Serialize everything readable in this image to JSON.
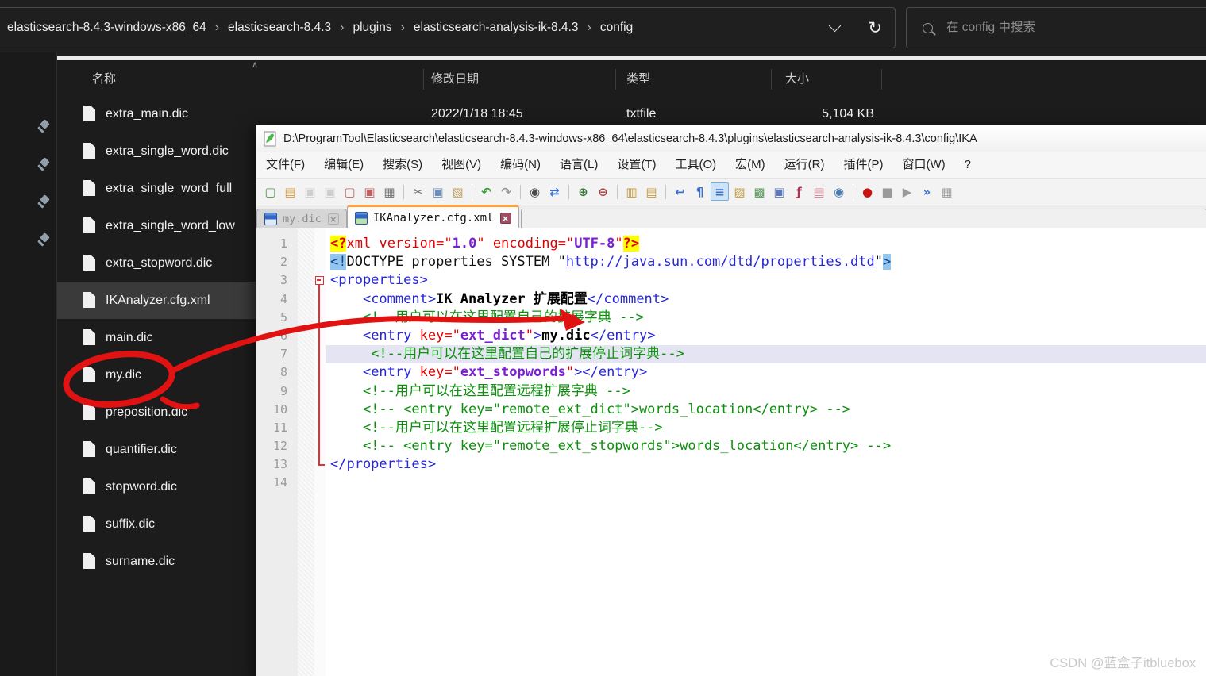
{
  "explorer": {
    "breadcrumb": [
      "elasticsearch-8.4.3-windows-x86_64",
      "elasticsearch-8.4.3",
      "plugins",
      "elasticsearch-analysis-ik-8.4.3",
      "config"
    ],
    "search_placeholder": "在 config 中搜索",
    "icons": {
      "refresh": "↻",
      "sort_ascending": "∧"
    },
    "columns": [
      "名称",
      "修改日期",
      "类型",
      "大小"
    ],
    "pin_count": 4,
    "files": [
      {
        "name": "extra_main.dic",
        "date": "2022/1/18 18:45",
        "type": "txtfile",
        "size": "5,104 KB"
      },
      {
        "name": "extra_single_word.dic"
      },
      {
        "name": "extra_single_word_full"
      },
      {
        "name": "extra_single_word_low"
      },
      {
        "name": "extra_stopword.dic"
      },
      {
        "name": "IKAnalyzer.cfg.xml",
        "selected": true
      },
      {
        "name": "main.dic"
      },
      {
        "name": "my.dic",
        "circled": true
      },
      {
        "name": "preposition.dic"
      },
      {
        "name": "quantifier.dic"
      },
      {
        "name": "stopword.dic"
      },
      {
        "name": "suffix.dic"
      },
      {
        "name": "surname.dic"
      }
    ]
  },
  "notepad": {
    "title": "D:\\ProgramTool\\Elasticsearch\\elasticsearch-8.4.3-windows-x86_64\\elasticsearch-8.4.3\\plugins\\elasticsearch-analysis-ik-8.4.3\\config\\IKA",
    "menus": [
      "文件(F)",
      "编辑(E)",
      "搜索(S)",
      "视图(V)",
      "编码(N)",
      "语言(L)",
      "设置(T)",
      "工具(O)",
      "宏(M)",
      "运行(R)",
      "插件(P)",
      "窗口(W)",
      "?"
    ],
    "toolbar": [
      {
        "name": "new-file",
        "glyph": "▢",
        "color": "#4a9a4a"
      },
      {
        "name": "open-file",
        "glyph": "▤",
        "color": "#d89b3c"
      },
      {
        "name": "save",
        "glyph": "▣",
        "color": "#9a9a9a",
        "disabled": true
      },
      {
        "name": "save-all",
        "glyph": "▣",
        "color": "#9a9a9a",
        "disabled": true
      },
      {
        "name": "close",
        "glyph": "▢",
        "color": "#c06060"
      },
      {
        "name": "close-all",
        "glyph": "▣",
        "color": "#c06060"
      },
      {
        "name": "print",
        "glyph": "▦",
        "color": "#707070"
      },
      {
        "sep": true
      },
      {
        "name": "cut",
        "glyph": "✂",
        "color": "#707070"
      },
      {
        "name": "copy",
        "glyph": "▣",
        "color": "#6f8fc0"
      },
      {
        "name": "paste",
        "glyph": "▧",
        "color": "#c0a060"
      },
      {
        "sep": true
      },
      {
        "name": "undo",
        "glyph": "↶",
        "color": "#2e9e2e"
      },
      {
        "name": "redo",
        "glyph": "↷",
        "color": "#9a9a9a"
      },
      {
        "sep": true
      },
      {
        "name": "find",
        "glyph": "◉",
        "color": "#4a4a4a"
      },
      {
        "name": "replace",
        "glyph": "⇄",
        "color": "#3a6fd0"
      },
      {
        "sep": true
      },
      {
        "name": "zoom-in",
        "glyph": "⊕",
        "color": "#3a7a3a"
      },
      {
        "name": "zoom-out",
        "glyph": "⊖",
        "color": "#b04040"
      },
      {
        "sep": true
      },
      {
        "name": "sync-vertical",
        "glyph": "▥",
        "color": "#c89a3c"
      },
      {
        "name": "sync-horizontal",
        "glyph": "▤",
        "color": "#c89a3c"
      },
      {
        "sep": true
      },
      {
        "name": "word-wrap",
        "glyph": "↩",
        "color": "#3a6fd0"
      },
      {
        "name": "show-all-characters",
        "glyph": "¶",
        "color": "#3a6fd0"
      },
      {
        "name": "indent-guide",
        "glyph": "≡",
        "color": "#3a6fd0",
        "active": true
      },
      {
        "name": "shortcut-mapper",
        "glyph": "▨",
        "color": "#c0a040"
      },
      {
        "name": "document-map",
        "glyph": "▩",
        "color": "#5a9a5a"
      },
      {
        "name": "document-switcher",
        "glyph": "▣",
        "color": "#5a7ac0"
      },
      {
        "name": "function-list",
        "glyph": "ƒ",
        "color": "#b03050"
      },
      {
        "name": "folder-as-workspace",
        "glyph": "▤",
        "color": "#d08090"
      },
      {
        "name": "monitoring-eye",
        "glyph": "◉",
        "color": "#4a7ab0"
      },
      {
        "sep": true
      },
      {
        "name": "macro-record",
        "glyph": "●",
        "color": "#cc1111"
      },
      {
        "name": "macro-stop",
        "glyph": "■",
        "color": "#9a9a9a"
      },
      {
        "name": "macro-play",
        "glyph": "▶",
        "color": "#9a9a9a"
      },
      {
        "name": "macro-run-multiple",
        "glyph": "»",
        "color": "#3a6fd0"
      },
      {
        "name": "macro-save",
        "glyph": "▦",
        "color": "#9a9a9a"
      }
    ],
    "tabs": [
      {
        "label": "my.dic",
        "active": false
      },
      {
        "label": "IKAnalyzer.cfg.xml",
        "active": true
      }
    ],
    "code": {
      "lines": [
        {
          "n": 1,
          "segs": [
            [
              "y",
              "<?"
            ],
            [
              "r",
              "xml"
            ],
            [
              "k",
              " "
            ],
            [
              "r",
              "version="
            ],
            [
              "q",
              "\""
            ],
            [
              "v",
              "1.0"
            ],
            [
              "q",
              "\""
            ],
            [
              "k",
              " "
            ],
            [
              "r",
              "encoding="
            ],
            [
              "q",
              "\""
            ],
            [
              "v",
              "UTF-8"
            ],
            [
              "q",
              "\""
            ],
            [
              "y",
              "?>"
            ]
          ]
        },
        {
          "n": 2,
          "segs": [
            [
              "hb",
              "<!"
            ],
            [
              "k",
              "DOCTYPE properties SYSTEM \""
            ],
            [
              "u",
              "http://java.sun.com/dtd/properties.dtd"
            ],
            [
              "k",
              "\""
            ],
            [
              "hb",
              ">"
            ]
          ]
        },
        {
          "n": 3,
          "fold": "start",
          "segs": [
            [
              "b",
              "<properties>"
            ]
          ]
        },
        {
          "n": 4,
          "fold": "line",
          "segs": [
            [
              "k",
              "    "
            ],
            [
              "b",
              "<comment>"
            ],
            [
              "t",
              "IK Analyzer 扩展配置"
            ],
            [
              "b",
              "</comment>"
            ]
          ]
        },
        {
          "n": 5,
          "fold": "line",
          "segs": [
            [
              "k",
              "    "
            ],
            [
              "g",
              "<!--用户可以在这里配置自己的扩展字典 -->"
            ]
          ]
        },
        {
          "n": 6,
          "fold": "line",
          "segs": [
            [
              "k",
              "    "
            ],
            [
              "b",
              "<entry"
            ],
            [
              "k",
              " "
            ],
            [
              "r",
              "key="
            ],
            [
              "q",
              "\""
            ],
            [
              "v",
              "ext_dict"
            ],
            [
              "q",
              "\""
            ],
            [
              "b",
              ">"
            ],
            [
              "t",
              "my.dic"
            ],
            [
              "b",
              "</entry>"
            ]
          ]
        },
        {
          "n": 7,
          "fold": "line",
          "hl": true,
          "segs": [
            [
              "k",
              "     "
            ],
            [
              "g",
              "<!--用户可以在这里配置自己的扩展停止词字典-->"
            ]
          ]
        },
        {
          "n": 8,
          "fold": "line",
          "segs": [
            [
              "k",
              "    "
            ],
            [
              "b",
              "<entry"
            ],
            [
              "k",
              " "
            ],
            [
              "r",
              "key="
            ],
            [
              "q",
              "\""
            ],
            [
              "v",
              "ext_stopwords"
            ],
            [
              "q",
              "\""
            ],
            [
              "b",
              "></entry>"
            ]
          ]
        },
        {
          "n": 9,
          "fold": "line",
          "segs": [
            [
              "k",
              "    "
            ],
            [
              "g",
              "<!--用户可以在这里配置远程扩展字典 -->"
            ]
          ]
        },
        {
          "n": 10,
          "fold": "line",
          "segs": [
            [
              "k",
              "    "
            ],
            [
              "g",
              "<!-- <entry key=\"remote_ext_dict\">words_location</entry> -->"
            ]
          ]
        },
        {
          "n": 11,
          "fold": "line",
          "segs": [
            [
              "k",
              "    "
            ],
            [
              "g",
              "<!--用户可以在这里配置远程扩展停止词字典-->"
            ]
          ]
        },
        {
          "n": 12,
          "fold": "line",
          "segs": [
            [
              "k",
              "    "
            ],
            [
              "g",
              "<!-- <entry key=\"remote_ext_stopwords\">words_location</entry> -->"
            ]
          ]
        },
        {
          "n": 13,
          "fold": "end",
          "segs": [
            [
              "b",
              "</properties>"
            ]
          ]
        },
        {
          "n": 14,
          "segs": []
        }
      ]
    }
  },
  "watermark": "CSDN @蓝盒子itbluebox"
}
